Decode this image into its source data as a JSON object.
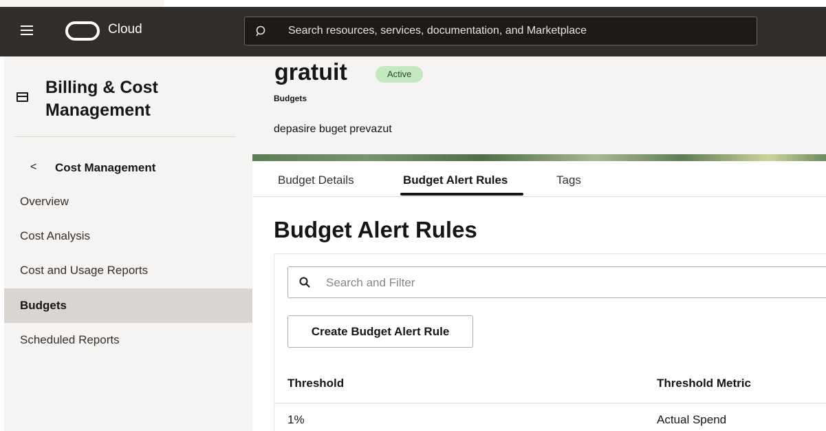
{
  "header": {
    "brand_label": "Cloud",
    "search_placeholder": "Search resources, services, documentation, and Marketplace"
  },
  "sidebar": {
    "title_line1": "Billing & Cost",
    "title_line2": "Management",
    "back_chevron": "<",
    "section_title": "Cost Management",
    "items": [
      {
        "label": "Overview",
        "active": false
      },
      {
        "label": "Cost Analysis",
        "active": false
      },
      {
        "label": "Cost and Usage Reports",
        "active": false
      },
      {
        "label": "Budgets",
        "active": true
      },
      {
        "label": "Scheduled Reports",
        "active": false
      }
    ]
  },
  "page": {
    "title": "gratuit",
    "status": "Active",
    "breadcrumb": "Budgets",
    "description": "depasire buget prevazut"
  },
  "tabs": [
    {
      "label": "Budget Details",
      "active": false
    },
    {
      "label": "Budget Alert Rules",
      "active": true
    },
    {
      "label": "Tags",
      "active": false
    }
  ],
  "content": {
    "title": "Budget Alert Rules",
    "filter_placeholder": "Search and Filter",
    "create_button_label": "Create Budget Alert Rule",
    "table": {
      "columns": [
        "Threshold",
        "Threshold Metric"
      ],
      "rows": [
        [
          "1%",
          "Actual Spend"
        ]
      ]
    }
  },
  "colors": {
    "header_bg": "#312d2a",
    "sidebar_bg": "#f5f4f2",
    "active_nav_bg": "#d9d6d2",
    "status_badge_bg": "#c5e8c1"
  }
}
